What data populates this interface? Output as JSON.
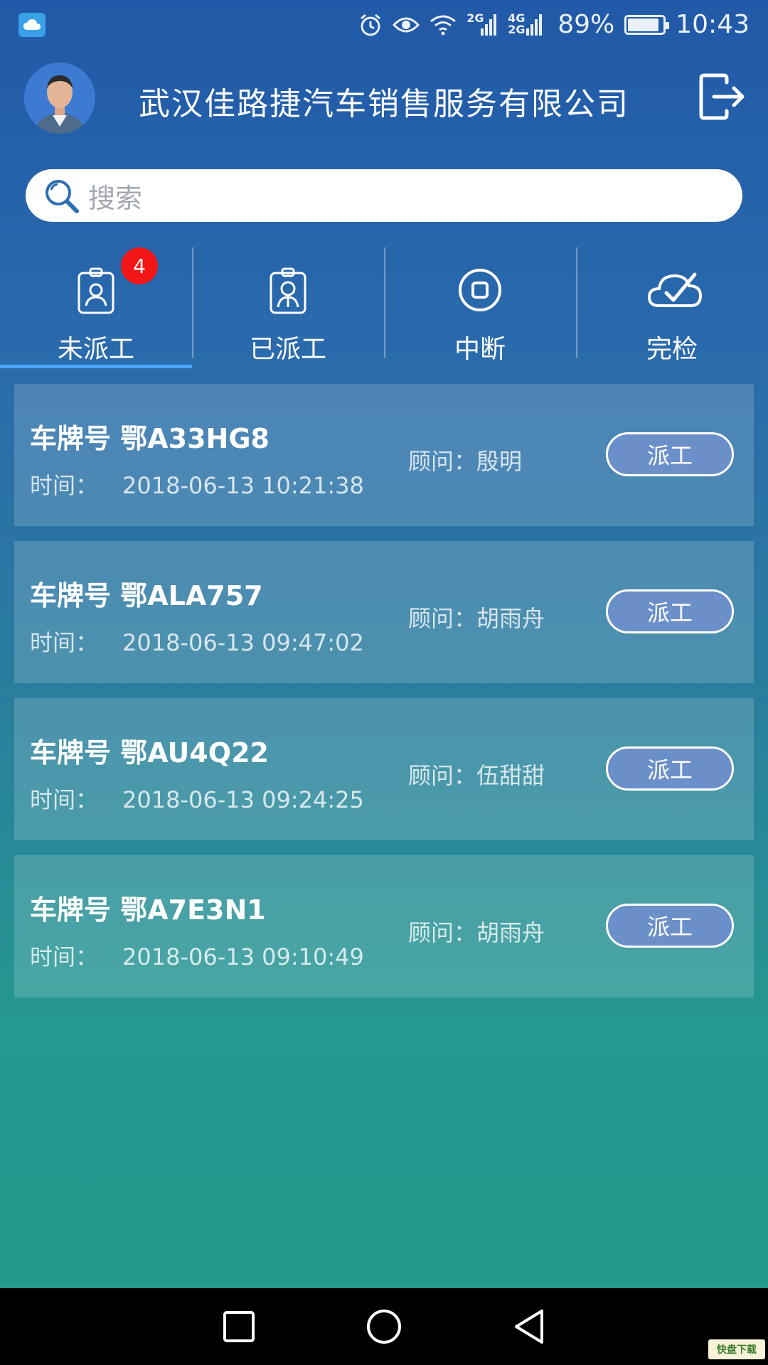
{
  "status_bar": {
    "battery_percent": "89%",
    "time": "10:43",
    "network_top": "2G",
    "network_bottom_a": "4G",
    "network_bottom_b": "2G",
    "battery_level": 0.89,
    "icons": [
      "app-icon",
      "alarm-icon",
      "eye-icon",
      "wifi-icon",
      "signal-icon",
      "signal-icon",
      "battery-icon"
    ]
  },
  "header": {
    "company": "武汉佳路捷汽车销售服务有限公司",
    "avatar": "avatar-photo",
    "logout_icon": "logout-icon"
  },
  "search": {
    "placeholder": "搜索"
  },
  "tabs": [
    {
      "label": "未派工",
      "icon": "id-badge-icon",
      "badge": "4",
      "active": true
    },
    {
      "label": "已派工",
      "icon": "id-badge-person-icon",
      "active": false
    },
    {
      "label": "中断",
      "icon": "stop-circle-icon",
      "active": false
    },
    {
      "label": "完检",
      "icon": "cloud-check-icon",
      "active": false
    }
  ],
  "orders": [
    {
      "plate_label": "车牌号",
      "plate": "鄂A33HG8",
      "time_label": "时间：",
      "time": "2018-06-13 10:21:38",
      "advisor_label": "顾问：",
      "advisor": "殷明",
      "action": "派工"
    },
    {
      "plate_label": "车牌号",
      "plate": "鄂ALA757",
      "time_label": "时间：",
      "time": "2018-06-13 09:47:02",
      "advisor_label": "顾问：",
      "advisor": "胡雨舟",
      "action": "派工"
    },
    {
      "plate_label": "车牌号",
      "plate": "鄂AU4Q22",
      "time_label": "时间：",
      "time": "2018-06-13 09:24:25",
      "advisor_label": "顾问：",
      "advisor": "伍甜甜",
      "action": "派工"
    },
    {
      "plate_label": "车牌号",
      "plate": "鄂A7E3N1",
      "time_label": "时间：",
      "time": "2018-06-13 09:10:49",
      "advisor_label": "顾问：",
      "advisor": "胡雨舟",
      "action": "派工"
    }
  ],
  "nav_bar": {
    "buttons": [
      "recents-square-icon",
      "home-circle-icon",
      "back-triangle-icon"
    ]
  },
  "watermark": {
    "text": "快盘下载"
  },
  "colors": {
    "badge": "#f21616",
    "button_fill": "#6b8fc9",
    "active_tab_line": "#4aa6ff",
    "top_gradient": "#2159a8",
    "bottom_gradient": "#21998a"
  }
}
